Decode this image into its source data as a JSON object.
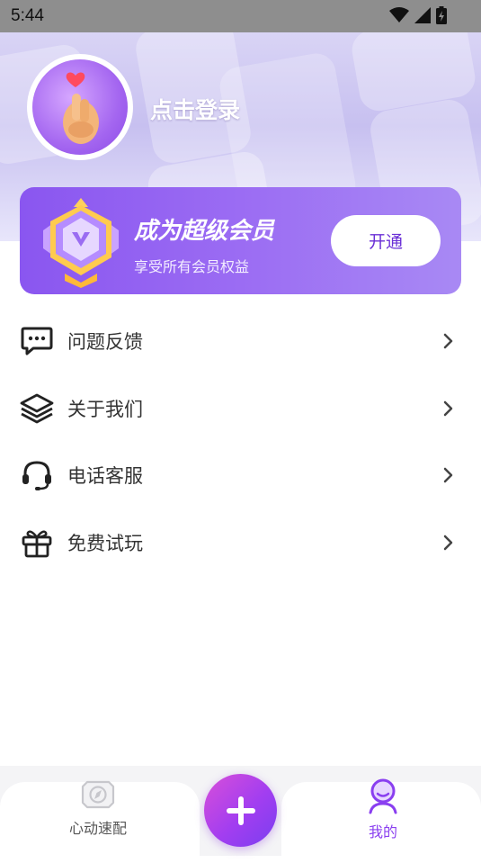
{
  "status_bar": {
    "time": "5:44"
  },
  "profile": {
    "login_text": "点击登录"
  },
  "vip": {
    "title": "成为超级会员",
    "subtitle": "享受所有会员权益",
    "button_label": "开通"
  },
  "menu": {
    "items": [
      {
        "label": "问题反馈",
        "icon": "feedback-chat-icon"
      },
      {
        "label": "关于我们",
        "icon": "layers-icon"
      },
      {
        "label": "电话客服",
        "icon": "headset-icon"
      },
      {
        "label": "免费试玩",
        "icon": "gift-icon"
      }
    ]
  },
  "bottom_nav": {
    "tabs": [
      {
        "label": "心动速配",
        "icon": "compass-icon",
        "active": false
      },
      {
        "label": "我的",
        "icon": "profile-icon",
        "active": true
      }
    ],
    "fab_icon": "plus-icon"
  },
  "colors": {
    "accent": "#8a3ff0",
    "active_tab": "#8a3ff0",
    "inactive_tab": "#555555"
  }
}
